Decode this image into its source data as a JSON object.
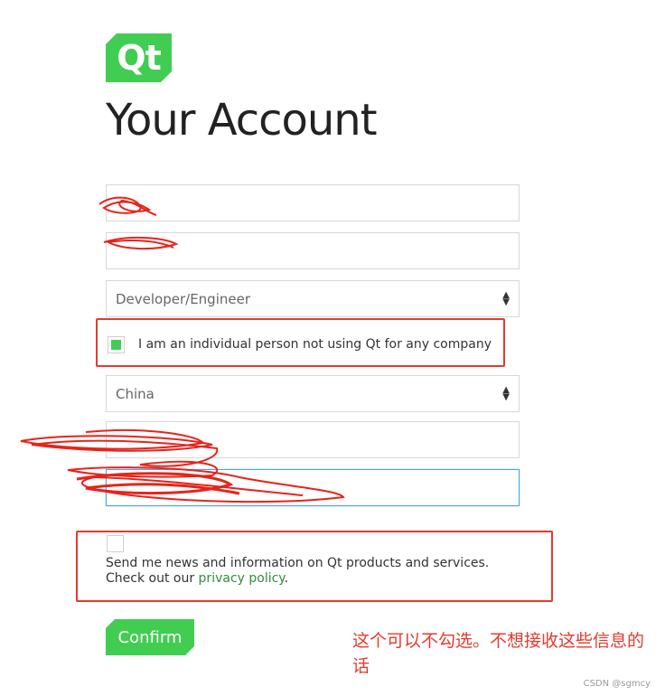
{
  "logo": {
    "text": "Qt"
  },
  "page_title": "Your Account",
  "fields": {
    "role_select": "Developer/Engineer",
    "individual_checkbox_label": "I am an individual person not using Qt for any company",
    "country_select": "China"
  },
  "news": {
    "text": "Send me news and information on Qt products and services. Check out our ",
    "link": "privacy policy",
    "suffix": "."
  },
  "confirm_label": "Confirm",
  "annotation_note": "这个可以不勾选。不想接收这些信息的话",
  "watermark": "CSDN @sgmcy",
  "colors": {
    "accent": "#41cd52",
    "annotation": "#e33b2e",
    "link": "#2f8f3a"
  }
}
